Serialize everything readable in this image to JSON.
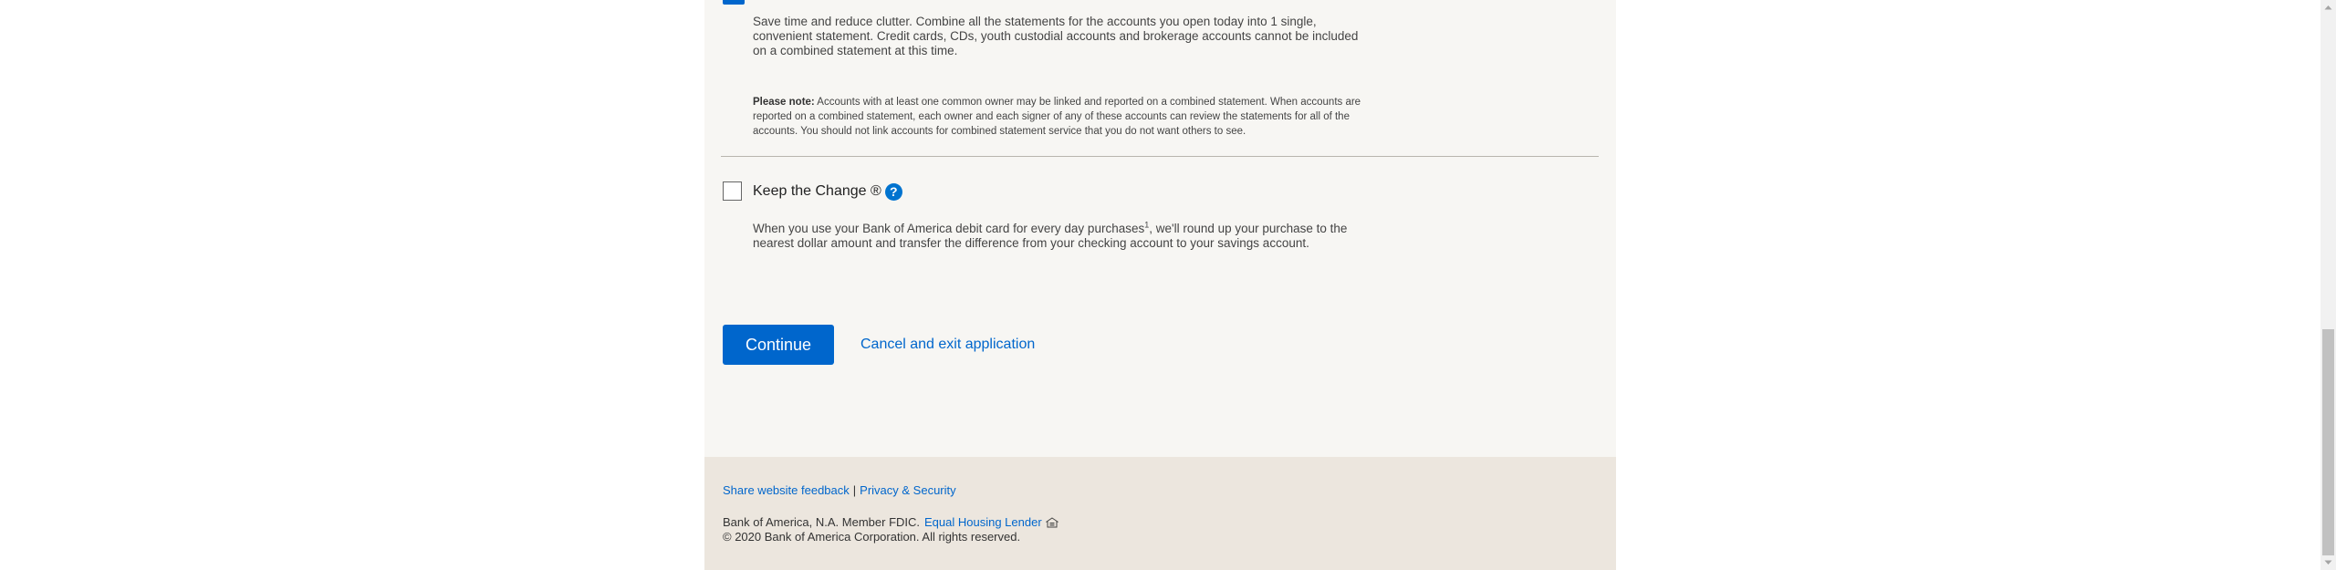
{
  "combined_statement": {
    "description": "Save time and reduce clutter. Combine all the statements for the accounts you open today into 1 single, convenient statement. Credit cards, CDs, youth custodial accounts and brokerage accounts cannot be included on a combined statement at this time.",
    "note_label": "Please note:",
    "note_text": " Accounts with at least one common owner may be linked and reported on a combined statement. When accounts are reported on a combined statement, each owner and each signer of any of these accounts can review the statements for all of the accounts. You should not link accounts for combined statement service that you do not want others to see."
  },
  "keep_the_change": {
    "label": "Keep the Change ®",
    "help_icon": "?",
    "description_before": "When you use your Bank of America debit card for every day purchases",
    "footnote": "1",
    "description_after": ", we'll round up your purchase to the nearest dollar amount and transfer the difference from your checking account to your savings account."
  },
  "actions": {
    "continue_label": "Continue",
    "cancel_label": "Cancel and exit application"
  },
  "footer": {
    "feedback_link": "Share website feedback",
    "separator": "|",
    "privacy_link": "Privacy & Security",
    "fdic_text": "Bank of America, N.A. Member FDIC.",
    "equal_housing_link": "Equal Housing Lender",
    "copyright": "© 2020 Bank of America Corporation. All rights reserved."
  },
  "colors": {
    "accent": "#0066cc",
    "content_bg": "#f7f6f3",
    "footer_bg": "#ece6de"
  }
}
